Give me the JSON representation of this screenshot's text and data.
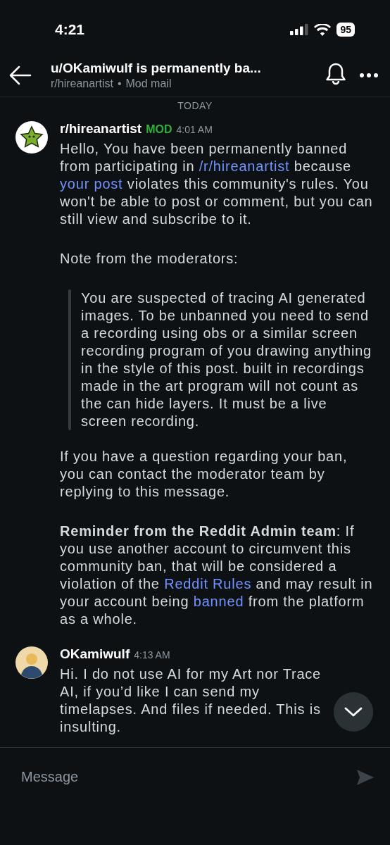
{
  "status_bar": {
    "time": "4:21",
    "battery": "95"
  },
  "header": {
    "title": "u/OKamiwulf is permanently ba...",
    "subreddit": "r/hireanartist",
    "separator": "•",
    "section": "Mod mail"
  },
  "date_divider": "TODAY",
  "messages": [
    {
      "author": "r/hireanartist",
      "badge": "MOD",
      "time": "4:01 AM",
      "avatar": {
        "kind": "star"
      },
      "blocks": [
        {
          "kind": "paragraph",
          "segments": [
            {
              "kind": "text",
              "text": "Hello, You have been permanently banned from participating in "
            },
            {
              "kind": "link",
              "text": "/r/hireanartist"
            },
            {
              "kind": "text",
              "text": " because "
            },
            {
              "kind": "link",
              "text": "your post"
            },
            {
              "kind": "text",
              "text": " violates this community's rules. You won't be able to post or comment, but you can still view and subscribe to it."
            }
          ]
        },
        {
          "kind": "paragraph",
          "segments": [
            {
              "kind": "text",
              "text": "Note from the moderators:"
            }
          ]
        },
        {
          "kind": "quote",
          "segments": [
            {
              "kind": "text",
              "text": "You are suspected of tracing AI generated images. To be unbanned you need to send a recording using obs or a similar screen recording program of you drawing anything in the style of this post. built in recordings made in the art program will not count as the can hide layers. It must be a live screen recording."
            }
          ]
        },
        {
          "kind": "paragraph",
          "segments": [
            {
              "kind": "text",
              "text": "If you have a question regarding your ban, you can contact the moderator team by replying to this message."
            }
          ]
        },
        {
          "kind": "paragraph",
          "segments": [
            {
              "kind": "bold",
              "text": "Reminder from the Reddit Admin team"
            },
            {
              "kind": "text",
              "text": ": If you use another account to circumvent this community ban, that will be considered a violation of the "
            },
            {
              "kind": "link",
              "text": "Reddit Rules"
            },
            {
              "kind": "text",
              "text": " and may result in your account being "
            },
            {
              "kind": "link",
              "text": "banned"
            },
            {
              "kind": "text",
              "text": " from the platform as a whole."
            }
          ]
        }
      ]
    },
    {
      "author": "OKamiwulf",
      "time": "4:13 AM",
      "avatar": {
        "kind": "user"
      },
      "blocks": [
        {
          "kind": "paragraph",
          "segments": [
            {
              "kind": "text",
              "text": "Hi. I do not use AI for my Art nor Trace AI, if you’d like I can send my timelapses. And files if needed. This is insulting."
            }
          ]
        }
      ]
    }
  ],
  "composer": {
    "placeholder": "Message"
  }
}
